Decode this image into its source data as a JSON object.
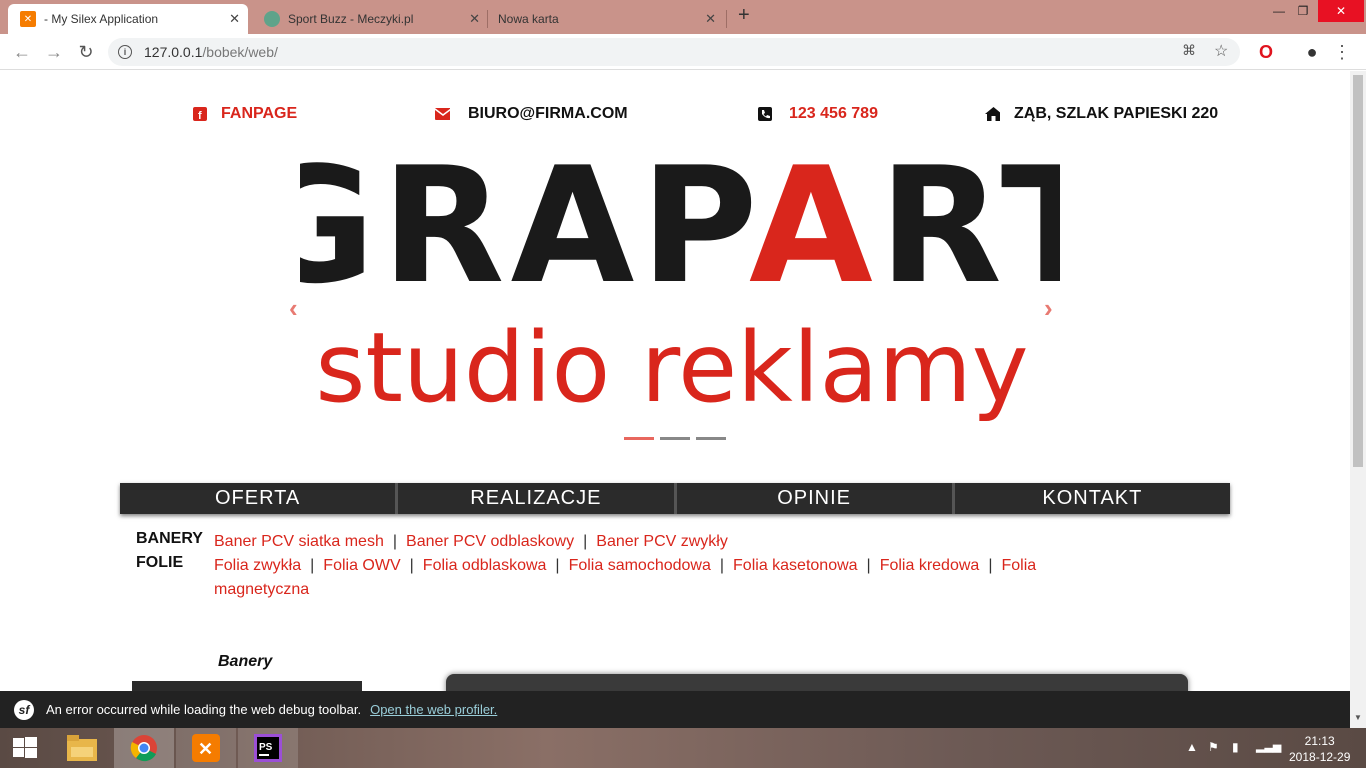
{
  "browser": {
    "tabs": [
      {
        "label": "- My Silex Application",
        "active": true
      },
      {
        "label": "Sport Buzz - Meczyki.pl",
        "active": false
      },
      {
        "label": "Nowa karta",
        "active": false
      }
    ],
    "url_host": "127.0.0.1",
    "url_path": "/bobek/web/"
  },
  "contacts": {
    "fanpage": "FANPAGE",
    "email": "BIURO@FIRMA.COM",
    "phone": "123 456 789",
    "address": "ZĄB, SZLAK PAPIESKI 220"
  },
  "logo": {
    "line1_a": "GRAP",
    "line1_b": "A",
    "line1_c": "RT",
    "line2": "studio reklamy"
  },
  "carousel": {
    "slides": 3,
    "active_slide": 1
  },
  "menu": [
    "OFERTA",
    "REALIZACJE",
    "OPINIE",
    "KONTAKT"
  ],
  "categories": [
    {
      "label": "BANERY",
      "links": [
        "Baner PCV siatka mesh",
        "Baner PCV odblaskowy",
        "Baner PCV zwykły"
      ]
    },
    {
      "label": "FOLIE",
      "links": [
        "Folia zwykła",
        "Folia OWV",
        "Folia odblaskowa",
        "Folia samochodowa",
        "Folia kasetonowa",
        "Folia kredowa",
        "Folia magnetyczna"
      ]
    }
  ],
  "section_title": "Banery",
  "debug": {
    "message": "An error occurred while loading the web debug toolbar.",
    "link": "Open the web profiler."
  },
  "taskbar": {
    "time": "21:13",
    "date": "2018-12-29"
  },
  "colors": {
    "accent": "#d9261c",
    "menu_bg": "#2b2b2b",
    "tab_bar": "#c9938a"
  }
}
